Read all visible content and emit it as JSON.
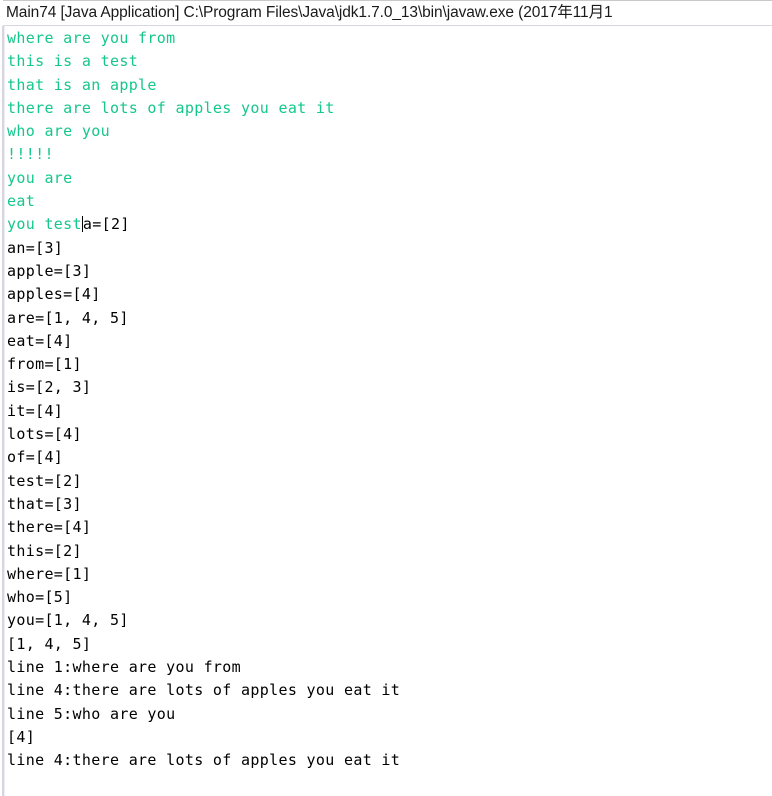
{
  "window": {
    "title": "Main74 [Java Application] C:\\Program Files\\Java\\jdk1.7.0_13\\bin\\javaw.exe (2017年11月1",
    "colors": {
      "stdout_green": "#16c78c",
      "stdout_black": "#000000",
      "background": "#ffffff",
      "left_border": "#d8d4e8",
      "title_text": "#1a1a1a"
    }
  },
  "console": {
    "lines": [
      {
        "id": "line-01",
        "color": "green",
        "text": "where are you from"
      },
      {
        "id": "line-02",
        "color": "green",
        "text": "this is a test"
      },
      {
        "id": "line-03",
        "color": "green",
        "text": "that is an apple"
      },
      {
        "id": "line-04",
        "color": "green",
        "text": "there are lots of apples you eat it"
      },
      {
        "id": "line-05",
        "color": "green",
        "text": "who are you"
      },
      {
        "id": "line-06",
        "color": "green",
        "text": "!!!!!"
      },
      {
        "id": "line-07",
        "color": "green",
        "text": "you are"
      },
      {
        "id": "line-08",
        "color": "green",
        "text": "eat"
      },
      {
        "id": "line-09",
        "color": "mixed",
        "green_text": "you test",
        "caret": true,
        "black_text": "a=[2]"
      },
      {
        "id": "line-10",
        "color": "black",
        "text": "an=[3]"
      },
      {
        "id": "line-11",
        "color": "black",
        "text": "apple=[3]"
      },
      {
        "id": "line-12",
        "color": "black",
        "text": "apples=[4]"
      },
      {
        "id": "line-13",
        "color": "black",
        "text": "are=[1, 4, 5]"
      },
      {
        "id": "line-14",
        "color": "black",
        "text": "eat=[4]"
      },
      {
        "id": "line-15",
        "color": "black",
        "text": "from=[1]"
      },
      {
        "id": "line-16",
        "color": "black",
        "text": "is=[2, 3]"
      },
      {
        "id": "line-17",
        "color": "black",
        "text": "it=[4]"
      },
      {
        "id": "line-18",
        "color": "black",
        "text": "lots=[4]"
      },
      {
        "id": "line-19",
        "color": "black",
        "text": "of=[4]"
      },
      {
        "id": "line-20",
        "color": "black",
        "text": "test=[2]"
      },
      {
        "id": "line-21",
        "color": "black",
        "text": "that=[3]"
      },
      {
        "id": "line-22",
        "color": "black",
        "text": "there=[4]"
      },
      {
        "id": "line-23",
        "color": "black",
        "text": "this=[2]"
      },
      {
        "id": "line-24",
        "color": "black",
        "text": "where=[1]"
      },
      {
        "id": "line-25",
        "color": "black",
        "text": "who=[5]"
      },
      {
        "id": "line-26",
        "color": "black",
        "text": "you=[1, 4, 5]"
      },
      {
        "id": "line-27",
        "color": "black",
        "text": "[1, 4, 5]"
      },
      {
        "id": "line-28",
        "color": "black",
        "text": "line 1:where are you from"
      },
      {
        "id": "line-29",
        "color": "black",
        "text": "line 4:there are lots of apples you eat it"
      },
      {
        "id": "line-30",
        "color": "black",
        "text": "line 5:who are you"
      },
      {
        "id": "line-31",
        "color": "black",
        "text": "[4]"
      },
      {
        "id": "line-32",
        "color": "black",
        "text": "line 4:there are lots of apples you eat it"
      }
    ]
  }
}
